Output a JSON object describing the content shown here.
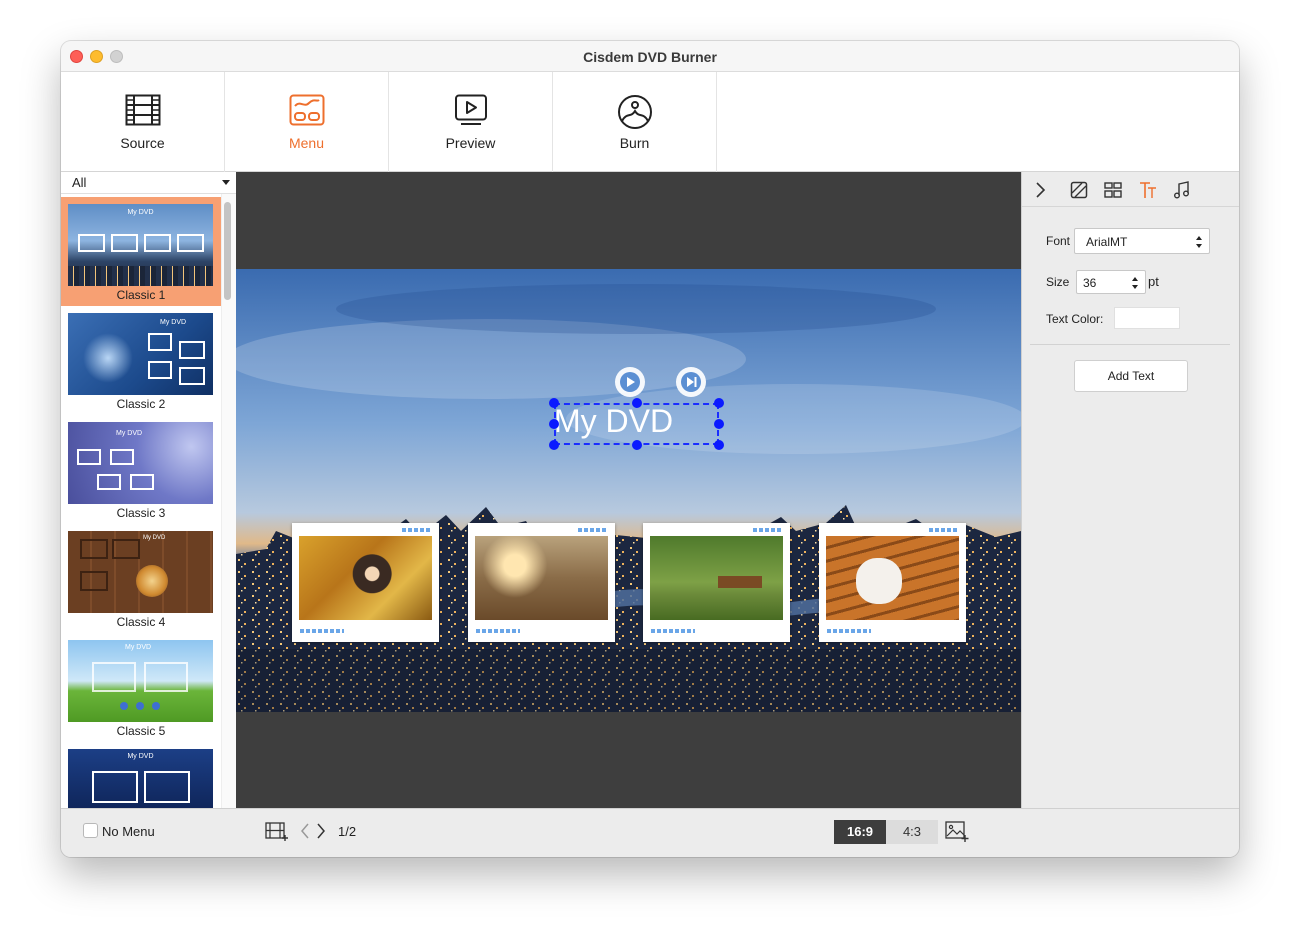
{
  "window": {
    "title": "Cisdem DVD Burner"
  },
  "toolbar": {
    "tabs": [
      {
        "label": "Source",
        "icon": "film-strip-icon",
        "active": false
      },
      {
        "label": "Menu",
        "icon": "menu-layout-icon",
        "active": true
      },
      {
        "label": "Preview",
        "icon": "play-monitor-icon",
        "active": false
      },
      {
        "label": "Burn",
        "icon": "disc-icon",
        "active": false
      }
    ],
    "accent_color": "#ee6f2d"
  },
  "templates": {
    "filter": "All",
    "items": [
      {
        "label": "Classic 1",
        "selected": true,
        "thumb_title": "My DVD"
      },
      {
        "label": "Classic 2",
        "selected": false,
        "thumb_title": "My DVD"
      },
      {
        "label": "Classic 3",
        "selected": false,
        "thumb_title": "My DVD"
      },
      {
        "label": "Classic 4",
        "selected": false,
        "thumb_title": "My DVD"
      },
      {
        "label": "Classic 5",
        "selected": false,
        "thumb_title": "My DVD"
      },
      {
        "label": "",
        "selected": false,
        "thumb_title": "My DVD"
      }
    ]
  },
  "canvas": {
    "menu_title": "My DVD",
    "buttons": [
      "play-icon",
      "skip-next-icon"
    ]
  },
  "properties": {
    "tabs": [
      "collapse-chevron-icon",
      "background-icon",
      "layout-icon",
      "text-icon",
      "music-icon"
    ],
    "active_tab": "text-icon",
    "font_label": "Font",
    "font_value": "ArialMT",
    "size_label": "Size",
    "size_value": "36",
    "size_unit": "pt",
    "text_color_label": "Text Color:",
    "text_color": "#ffffff",
    "add_text_label": "Add Text"
  },
  "bottom": {
    "no_menu_label": "No Menu",
    "page_indicator": "1/2",
    "ratio_active": "16:9",
    "ratio_inactive": "4:3"
  }
}
